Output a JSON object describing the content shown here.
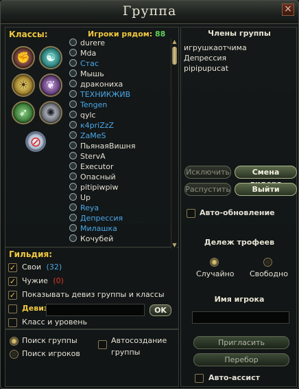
{
  "window": {
    "title": "Группа",
    "close_glyph": "×"
  },
  "classes": {
    "label": "Классы:",
    "icons": [
      "class-warrior-icon",
      "class-mage-icon",
      "class-priest-icon",
      "class-warlock-icon",
      "class-scout-icon",
      "class-psionic-icon",
      "class-no-filter-icon"
    ]
  },
  "nearby": {
    "label": "Игроки рядом:",
    "count": "88",
    "players": [
      {
        "name": "durere",
        "color": "#e6e2d6"
      },
      {
        "name": "Mda",
        "color": "#e6e2d6"
      },
      {
        "name": "Стас",
        "color": "#4aa8e8"
      },
      {
        "name": "Мышь",
        "color": "#e6e2d6"
      },
      {
        "name": "дракониха",
        "color": "#e6e2d6"
      },
      {
        "name": "ТЕХНИКЖИВ",
        "color": "#4aa8e8"
      },
      {
        "name": "Tengen",
        "color": "#4aa8e8"
      },
      {
        "name": "qylc",
        "color": "#e6e2d6"
      },
      {
        "name": "к4priZzZ",
        "color": "#4aa8e8"
      },
      {
        "name": "ZaMeS",
        "color": "#4aa8e8"
      },
      {
        "name": "ПьянаяВишня",
        "color": "#e6e2d6"
      },
      {
        "name": "StervA",
        "color": "#e6e2d6"
      },
      {
        "name": "Executor",
        "color": "#e6e2d6"
      },
      {
        "name": "Опасный",
        "color": "#e6e2d6"
      },
      {
        "name": "pitipiwpiw",
        "color": "#e6e2d6"
      },
      {
        "name": "Up",
        "color": "#e6e2d6"
      },
      {
        "name": "Reya",
        "color": "#4aa8e8"
      },
      {
        "name": "Депрессия",
        "color": "#4aa8e8"
      },
      {
        "name": "Милашка",
        "color": "#4aa8e8"
      },
      {
        "name": "Кочубей",
        "color": "#e6e2d6"
      }
    ]
  },
  "guild": {
    "label": "Гильдия:",
    "own_label": "Свои",
    "own_count": "(32)",
    "foreign_label": "Чужие",
    "foreign_count": "(0)",
    "show_motto_label": "Показывать девиз группы и классы",
    "motto_label": "Девиз",
    "motto_value": "",
    "ok_label": "OK",
    "class_level_label": "Класс и уровень"
  },
  "search": {
    "group_search_label": "Поиск группы",
    "player_search_label": "Поиск игроков",
    "auto_create_label_1": "Автосоздание",
    "auto_create_label_2": "группы"
  },
  "members": {
    "label": "Члены группы",
    "list": [
      "игрушкаотчима",
      "Депрессия",
      "pipipupucat"
    ]
  },
  "actions": {
    "kick_label": "Исключить",
    "change_leader_label": "Смена лидера",
    "disband_label": "Распустить",
    "leave_label": "Выйти",
    "auto_update_label": "Авто-обновление"
  },
  "loot": {
    "label": "Дележ трофеев",
    "random_label": "Случайно",
    "free_label": "Свободно"
  },
  "player_name": {
    "label": "Имя игрока",
    "value": "",
    "invite_label": "Пригласить",
    "reassign_label": "Перебор",
    "auto_assist_label": "Авто-ассист"
  }
}
